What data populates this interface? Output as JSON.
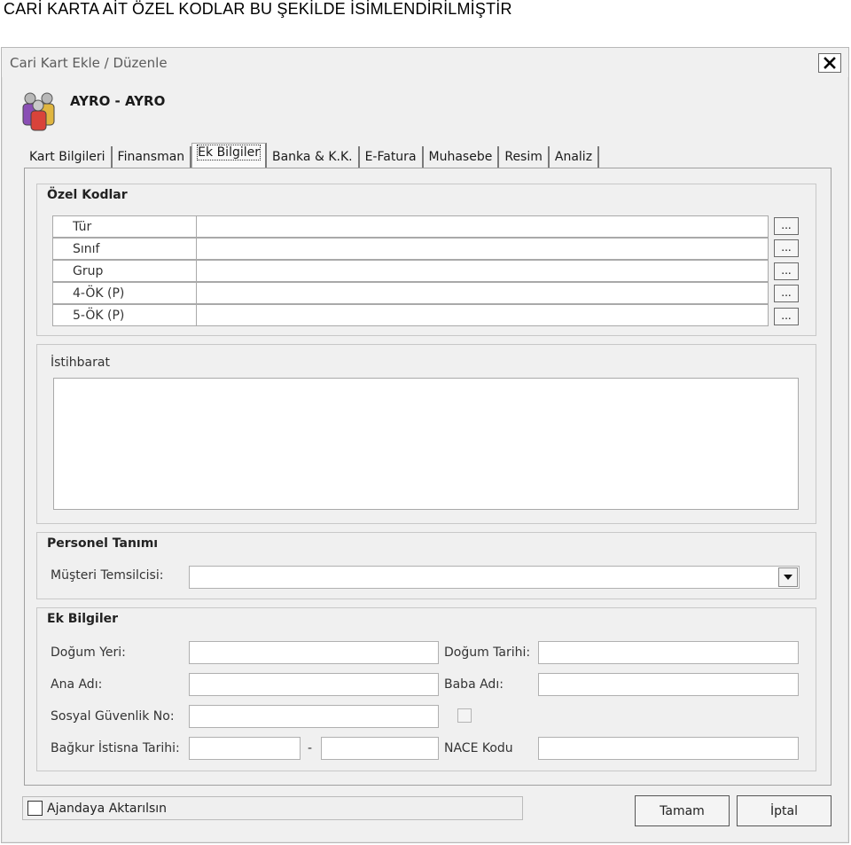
{
  "caption": "CARİ KARTA AİT ÖZEL KODLAR BU ŞEKİLDE İSİMLENDİRİLMİŞTİR",
  "window": {
    "title": "Cari Kart Ekle / Düzenle",
    "company_name": "AYRO - AYRO"
  },
  "tabs": [
    {
      "label": "Kart Bilgileri"
    },
    {
      "label": "Finansman"
    },
    {
      "label": "Ek Bilgiler",
      "active": true
    },
    {
      "label": "Banka & K.K."
    },
    {
      "label": "E-Fatura"
    },
    {
      "label": "Muhasebe"
    },
    {
      "label": "Resim"
    },
    {
      "label": "Analiz"
    }
  ],
  "ozel_kodlar": {
    "title": "Özel Kodlar",
    "rows": [
      {
        "label": "Tür",
        "value": "",
        "button": "..."
      },
      {
        "label": "Sınıf",
        "value": "",
        "button": "..."
      },
      {
        "label": "Grup",
        "value": "",
        "button": "..."
      },
      {
        "label": "4-ÖK (P)",
        "value": "",
        "button": "..."
      },
      {
        "label": "5-ÖK (P)",
        "value": "",
        "button": "..."
      }
    ]
  },
  "istihbarat": {
    "title": "İstihbarat",
    "value": ""
  },
  "personel": {
    "title": "Personel Tanımı",
    "musteri_temsilcisi_label": "Müşteri Temsilcisi:",
    "musteri_temsilcisi_value": ""
  },
  "ek_bilgiler": {
    "title": "Ek Bilgiler",
    "dogum_yeri_label": "Doğum Yeri:",
    "dogum_tarihi_label": "Doğum Tarihi:",
    "ana_adi_label": "Ana Adı:",
    "baba_adi_label": "Baba Adı:",
    "sgk_label": "Sosyal Güvenlik No:",
    "bagkur_label": "Bağkur İstisna Tarihi:",
    "range_separator": "-",
    "nace_label": "NACE Kodu"
  },
  "footer": {
    "ajanda_label": "Ajandaya Aktarılsın",
    "ok_label": "Tamam",
    "cancel_label": "İptal"
  },
  "icons": {
    "close": "close-icon",
    "users": "users-icon",
    "dropdown": "chevron-down-icon"
  }
}
